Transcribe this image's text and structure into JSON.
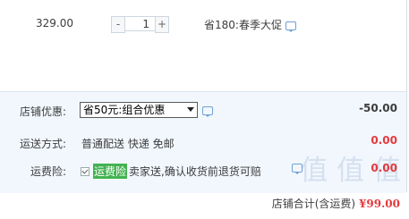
{
  "item": {
    "price": "329.00",
    "quantity": "1",
    "minus_label": "-",
    "plus_label": "+",
    "promotion": "省180:春季大促"
  },
  "shop": {
    "discount_label": "店铺优惠:",
    "discount_selected": "省50元:组合优惠",
    "discount_amount": "-50.00",
    "shipping_label": "运送方式:",
    "shipping_value": "普通配送 快递 免邮",
    "shipping_amount": "0.00",
    "insurance_label": "运费险:",
    "insurance_tag": "运费险",
    "insurance_desc": "卖家送,确认收货前退货可赔",
    "insurance_amount": "0.00",
    "insurance_checked": true,
    "watermark": "值 值 值"
  },
  "total": {
    "label": "店铺合计(含运费)",
    "value": "¥99.00"
  },
  "colors": {
    "accent_red": "#e4393c",
    "tag_green": "#43b351",
    "panel_bg": "#f2f7fe"
  }
}
